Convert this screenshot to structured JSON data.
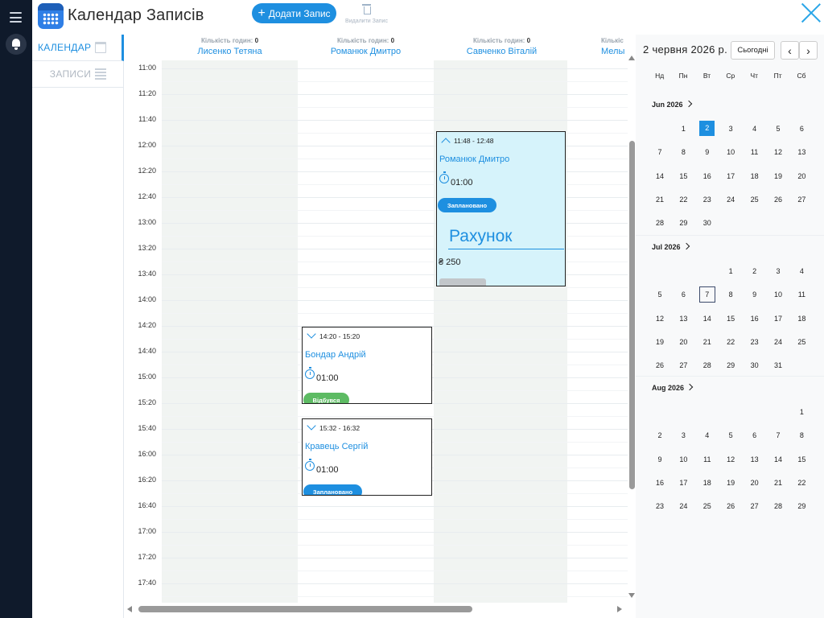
{
  "header": {
    "app_title": "Календар Записів",
    "add_button": "Додати Запис",
    "delete_label": "Видалити Запис",
    "accent": "#1e8fe0"
  },
  "nav": {
    "calendar": "КАЛЕНДАР",
    "records": "ЗАПИСИ"
  },
  "columns": [
    {
      "hours_label": "Кількість годин:",
      "hours": "0",
      "name": "Лисенко Тетяна"
    },
    {
      "hours_label": "Кількість годин:",
      "hours": "0",
      "name": "Романюк Дмитро"
    },
    {
      "hours_label": "Кількість годин:",
      "hours": "0",
      "name": "Савченко Віталій"
    },
    {
      "hours_label": "Кількіс",
      "hours": "",
      "name": "Мелы"
    }
  ],
  "times": [
    "11:00",
    "11:20",
    "11:40",
    "12:00",
    "12:20",
    "12:40",
    "13:00",
    "13:20",
    "13:40",
    "14:00",
    "14:20",
    "14:40",
    "15:00",
    "15:20",
    "15:40",
    "16:00",
    "16:20",
    "16:40",
    "17:00",
    "17:20",
    "17:40"
  ],
  "events": [
    {
      "time": "11:48 - 12:48",
      "client": "Романюк Дмитро",
      "duration": "01:00",
      "status": "Заплановано",
      "status_color": "#1e8fe0",
      "invoice_label": "Рахунок",
      "amount": "₴ 250",
      "expanded": true
    },
    {
      "time": "14:20 - 15:20",
      "client": "Бондар Андрій",
      "duration": "01:00",
      "status": "Відбувся",
      "status_color": "#5dbb63",
      "expanded": false
    },
    {
      "time": "15:32 - 16:32",
      "client": "Кравець Сергій",
      "duration": "01:00",
      "status": "Заплановано",
      "status_color": "#1e8fe0",
      "expanded": false
    }
  ],
  "sidebar": {
    "date_title": "2 червня 2026 р.",
    "today": "Сьогодні",
    "prev": "‹",
    "next": "›",
    "weekdays": [
      "Нд",
      "Пн",
      "Вт",
      "Ср",
      "Чт",
      "Пт",
      "Сб"
    ],
    "months": [
      {
        "label": "Jun 2026",
        "rows": [
          [
            "",
            "1",
            "2",
            "3",
            "4",
            "5",
            "6"
          ],
          [
            "7",
            "8",
            "9",
            "10",
            "11",
            "12",
            "13"
          ],
          [
            "14",
            "15",
            "16",
            "17",
            "18",
            "19",
            "20"
          ],
          [
            "21",
            "22",
            "23",
            "24",
            "25",
            "26",
            "27"
          ],
          [
            "28",
            "29",
            "30",
            "",
            "",
            "",
            ""
          ]
        ],
        "selected": "2"
      },
      {
        "label": "Jul 2026",
        "rows": [
          [
            "",
            "",
            "",
            "1",
            "2",
            "3",
            "4"
          ],
          [
            "5",
            "6",
            "7",
            "8",
            "9",
            "10",
            "11"
          ],
          [
            "12",
            "13",
            "14",
            "15",
            "16",
            "17",
            "18"
          ],
          [
            "19",
            "20",
            "21",
            "22",
            "23",
            "24",
            "25"
          ],
          [
            "26",
            "27",
            "28",
            "29",
            "30",
            "31",
            ""
          ]
        ],
        "today": "7"
      },
      {
        "label": "Aug 2026",
        "rows": [
          [
            "",
            "",
            "",
            "",
            "",
            "",
            "1"
          ],
          [
            "2",
            "3",
            "4",
            "5",
            "6",
            "7",
            "8"
          ],
          [
            "9",
            "10",
            "11",
            "12",
            "13",
            "14",
            "15"
          ],
          [
            "16",
            "17",
            "18",
            "19",
            "20",
            "21",
            "22"
          ],
          [
            "23",
            "24",
            "25",
            "26",
            "27",
            "28",
            "29"
          ]
        ]
      }
    ]
  }
}
